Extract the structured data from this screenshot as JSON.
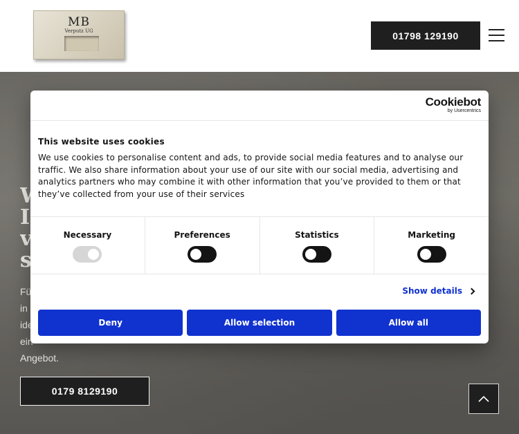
{
  "header": {
    "logo_text": "MB",
    "logo_sub": "Verputz UG",
    "phone_label": "01798 129190"
  },
  "hero": {
    "title_lines": [
      "W",
      "I",
      "v",
      "s"
    ],
    "text_lines": [
      "Fü",
      "in",
      "ide",
      "ein",
      "Angebot."
    ],
    "cta_label": "0179 8129190"
  },
  "cookie": {
    "brand": "Cookiebot",
    "brand_sub": "by Usercentrics",
    "title": "This website uses cookies",
    "body": "We use cookies to personalise content and ads, to provide social media features and to analyse our traffic. We also share information about your use of our site with our social media, advertising and analytics partners who may combine it with other information that you’ve provided to them or that they’ve collected from your use of their services",
    "categories": [
      {
        "label": "Necessary",
        "state": "on-disabled"
      },
      {
        "label": "Preferences",
        "state": "off"
      },
      {
        "label": "Statistics",
        "state": "off"
      },
      {
        "label": "Marketing",
        "state": "off"
      }
    ],
    "show_details": "Show details",
    "buttons": {
      "deny": "Deny",
      "allow_selection": "Allow selection",
      "allow_all": "Allow all"
    },
    "accent_color": "#1032cf"
  }
}
